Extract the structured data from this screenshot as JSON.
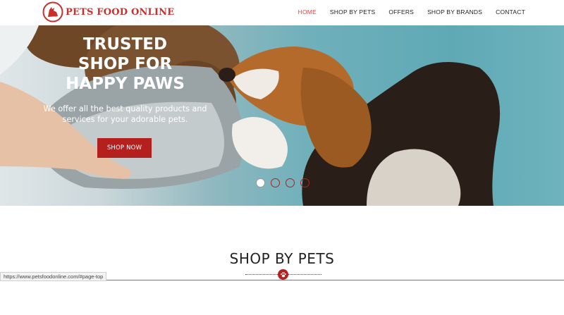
{
  "brand": {
    "name": "PETS FOOD ONLINE"
  },
  "nav": {
    "items": [
      {
        "label": "HOME",
        "active": true
      },
      {
        "label": "SHOP BY PETS",
        "active": false
      },
      {
        "label": "OFFERS",
        "active": false
      },
      {
        "label": "SHOP BY BRANDS",
        "active": false
      },
      {
        "label": "CONTACT",
        "active": false
      }
    ]
  },
  "hero": {
    "title_line1": "TRUSTED",
    "title_line2": "SHOP FOR",
    "title_line3": "HAPPY PAWS",
    "subtitle_line1": "We offer all the best quality products and",
    "subtitle_line2": "services for your adorable pets.",
    "cta_label": "SHOP NOW",
    "slides": 4,
    "active_slide": 1
  },
  "section": {
    "title": "SHOP BY PETS"
  },
  "status_bar": {
    "url": "https://www.petsfoodonline.com/#page-top"
  },
  "colors": {
    "brand": "#c9302c",
    "nav_active": "#d9463e",
    "button": "#b3201e"
  }
}
